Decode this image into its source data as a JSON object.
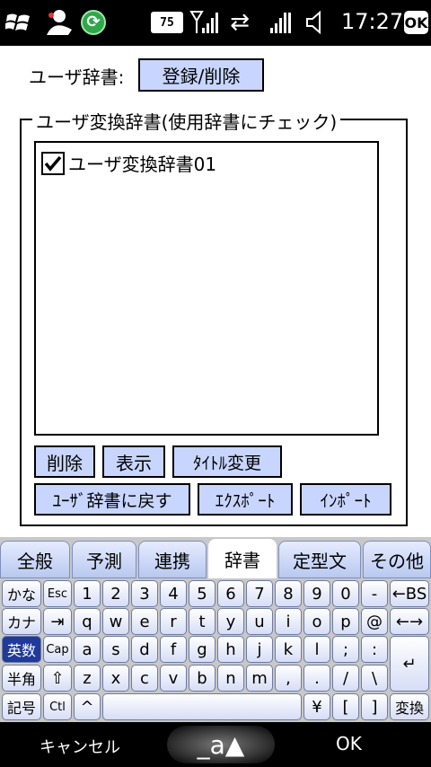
{
  "status": {
    "battery": "75",
    "time": "17:27",
    "ok": "OK"
  },
  "dictionary": {
    "label": "ユーザ辞書:",
    "register_button": "登録/削除"
  },
  "group": {
    "legend": "ユーザ変換辞書(使用辞書にチェック)",
    "items": [
      {
        "label": "ユーザ変換辞書01",
        "checked": true
      }
    ],
    "buttons": {
      "delete": "削除",
      "show": "表示",
      "rename": "ﾀｲﾄﾙ変更",
      "back": "ﾕｰｻﾞ辞書に戻す",
      "export": "ｴｸｽﾎﾟｰﾄ",
      "import": "ｲﾝﾎﾟｰﾄ"
    }
  },
  "keyboard": {
    "tabs": [
      "全般",
      "予測",
      "連携",
      "辞書",
      "定型文",
      "その他"
    ],
    "active_tab": "辞書",
    "row1": [
      "かな",
      "Esc",
      "1",
      "2",
      "3",
      "4",
      "5",
      "6",
      "7",
      "8",
      "9",
      "0",
      "-",
      "←BS"
    ],
    "row2": [
      "カナ",
      "⇥",
      "q",
      "w",
      "e",
      "r",
      "t",
      "y",
      "u",
      "i",
      "o",
      "p",
      "@",
      "←→"
    ],
    "row3": [
      "英数",
      "Cap",
      "a",
      "s",
      "d",
      "f",
      "g",
      "h",
      "j",
      "k",
      "l",
      ";",
      ":",
      "↵"
    ],
    "row4": [
      "半角",
      "⇧",
      "z",
      "x",
      "c",
      "v",
      "b",
      "n",
      "m",
      ",",
      ".",
      "/",
      "\\"
    ],
    "row5": [
      "記号",
      "Ctl",
      "^",
      "",
      "¥",
      "[",
      "]",
      "変換"
    ]
  },
  "bottom": {
    "cancel": "キャンセル",
    "ime": "_a▲",
    "ok": "OK"
  }
}
